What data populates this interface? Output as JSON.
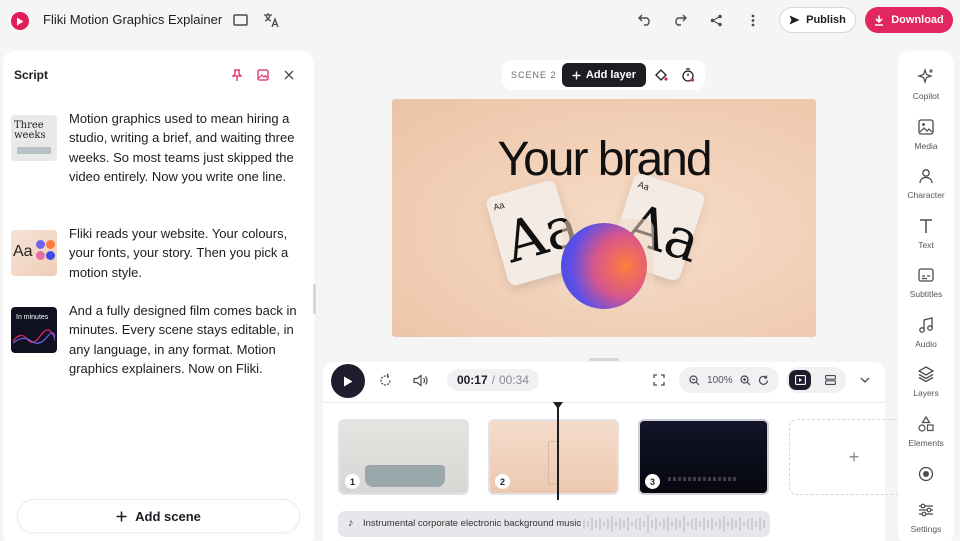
{
  "app": {
    "title": "Fliki Motion Graphics Explainer"
  },
  "toolbar": {
    "publish_label": "Publish",
    "download_label": "Download"
  },
  "script_panel": {
    "title": "Script",
    "scenes": [
      {
        "thumb_text": "Three weeks",
        "text": "Motion graphics used to mean hiring a studio, writing a brief, and waiting three weeks. So most teams just skipped the video entirely. Now you write one line."
      },
      {
        "thumb_text": "Aa",
        "text": "Fliki reads your website. Your colours, your fonts, your story. Then you pick a motion style."
      },
      {
        "thumb_text": "In minutes",
        "text": "And a fully designed film comes back in minutes. Every scene stays editable, in any language, in any format. Motion graphics explainers. Now on Fliki."
      }
    ],
    "add_scene_label": "Add scene"
  },
  "scene_toolbar": {
    "scene_label": "SCENE 2",
    "add_layer_label": "Add layer"
  },
  "canvas": {
    "headline": "Your brand",
    "card_small_left": "Aa",
    "card_glyph_left": "Aa",
    "card_small_right": "Aa",
    "card_glyph_right": "Aa"
  },
  "player": {
    "current_time": "00:17",
    "separator": "/",
    "total_time": "00:34",
    "zoom": "100%"
  },
  "timeline": {
    "clips": [
      {
        "number": "1"
      },
      {
        "number": "2"
      },
      {
        "number": "3"
      }
    ],
    "add_clip_label": "+",
    "audio_track": "Instrumental corporate electronic background music"
  },
  "right_rail": [
    {
      "label": "Copilot",
      "icon": "sparkle-icon"
    },
    {
      "label": "Media",
      "icon": "image-icon"
    },
    {
      "label": "Character",
      "icon": "person-icon"
    },
    {
      "label": "Text",
      "icon": "text-icon"
    },
    {
      "label": "Subtitles",
      "icon": "subtitles-icon"
    },
    {
      "label": "Audio",
      "icon": "music-icon"
    },
    {
      "label": "Layers",
      "icon": "layers-icon"
    },
    {
      "label": "Elements",
      "icon": "shapes-icon"
    },
    {
      "label": "",
      "icon": "record-icon"
    },
    {
      "label": "Settings",
      "icon": "sliders-icon"
    }
  ],
  "colors": {
    "accent": "#e2265f",
    "dark": "#1d1d2e",
    "panel": "#ffffff",
    "background": "#f5f5f6"
  }
}
